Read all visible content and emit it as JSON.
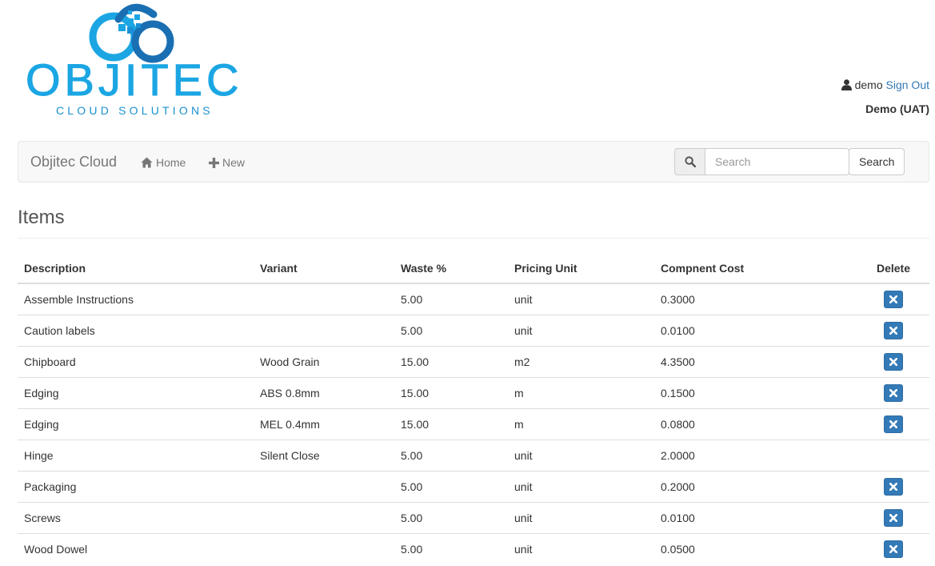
{
  "logo": {
    "name": "OBJITEC",
    "tagline": "CLOUD SOLUTIONS",
    "colors": {
      "primary": "#1ba6e3",
      "secondary": "#1b90d0",
      "dark": "#1a6fb3"
    }
  },
  "user": {
    "icon": "user-icon",
    "username": "demo",
    "sign_out_label": "Sign Out",
    "environment": "Demo (UAT)"
  },
  "navbar": {
    "brand": "Objitec Cloud",
    "home_label": "Home",
    "home_icon": "home-icon",
    "new_label": "New",
    "new_icon": "plus-icon",
    "search_icon": "search-icon",
    "search_placeholder": "Search",
    "search_button_label": "Search"
  },
  "page": {
    "title": "Items"
  },
  "table": {
    "columns": [
      "Description",
      "Variant",
      "Waste %",
      "Pricing Unit",
      "Compnent Cost",
      "Delete"
    ],
    "rows": [
      {
        "description": "Assemble Instructions",
        "variant": "",
        "waste": "5.00",
        "pricing_unit": "unit",
        "cost": "0.3000",
        "deletable": true
      },
      {
        "description": "Caution labels",
        "variant": "",
        "waste": "5.00",
        "pricing_unit": "unit",
        "cost": "0.0100",
        "deletable": true
      },
      {
        "description": "Chipboard",
        "variant": "Wood Grain",
        "waste": "15.00",
        "pricing_unit": "m2",
        "cost": "4.3500",
        "deletable": true
      },
      {
        "description": "Edging",
        "variant": "ABS 0.8mm",
        "waste": "15.00",
        "pricing_unit": "m",
        "cost": "0.1500",
        "deletable": true
      },
      {
        "description": "Edging",
        "variant": "MEL 0.4mm",
        "waste": "15.00",
        "pricing_unit": "m",
        "cost": "0.0800",
        "deletable": true
      },
      {
        "description": "Hinge",
        "variant": "Silent Close",
        "waste": "5.00",
        "pricing_unit": "unit",
        "cost": "2.0000",
        "deletable": false
      },
      {
        "description": "Packaging",
        "variant": "",
        "waste": "5.00",
        "pricing_unit": "unit",
        "cost": "0.2000",
        "deletable": true
      },
      {
        "description": "Screws",
        "variant": "",
        "waste": "5.00",
        "pricing_unit": "unit",
        "cost": "0.0100",
        "deletable": true
      },
      {
        "description": "Wood Dowel",
        "variant": "",
        "waste": "5.00",
        "pricing_unit": "unit",
        "cost": "0.0500",
        "deletable": true
      }
    ],
    "delete_icon": "close-icon",
    "delete_button_color": "#337ab7"
  }
}
